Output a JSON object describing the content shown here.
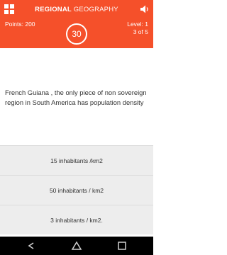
{
  "header": {
    "title_bold": "REGIONAL",
    "title_light": "GEOGRAPHY",
    "points": "Points: 200",
    "timer": "30",
    "level": "Level: 1",
    "progress": "3 of 5",
    "menu_icon": "grid-icon",
    "sound_icon": "speaker-icon"
  },
  "question": {
    "text": "French Guiana  , the only piece of non sovereign region in South America has population density"
  },
  "answers": [
    {
      "label": "15 inhabitants /km2"
    },
    {
      "label": "50 inhabitants  / km2"
    },
    {
      "label": "3 inhabitants / km2."
    }
  ],
  "navbar": {
    "icons": [
      "back-icon",
      "home-icon",
      "recent-apps-icon"
    ]
  },
  "colors": {
    "accent": "#f5502a",
    "answer_bg": "#ededed"
  }
}
